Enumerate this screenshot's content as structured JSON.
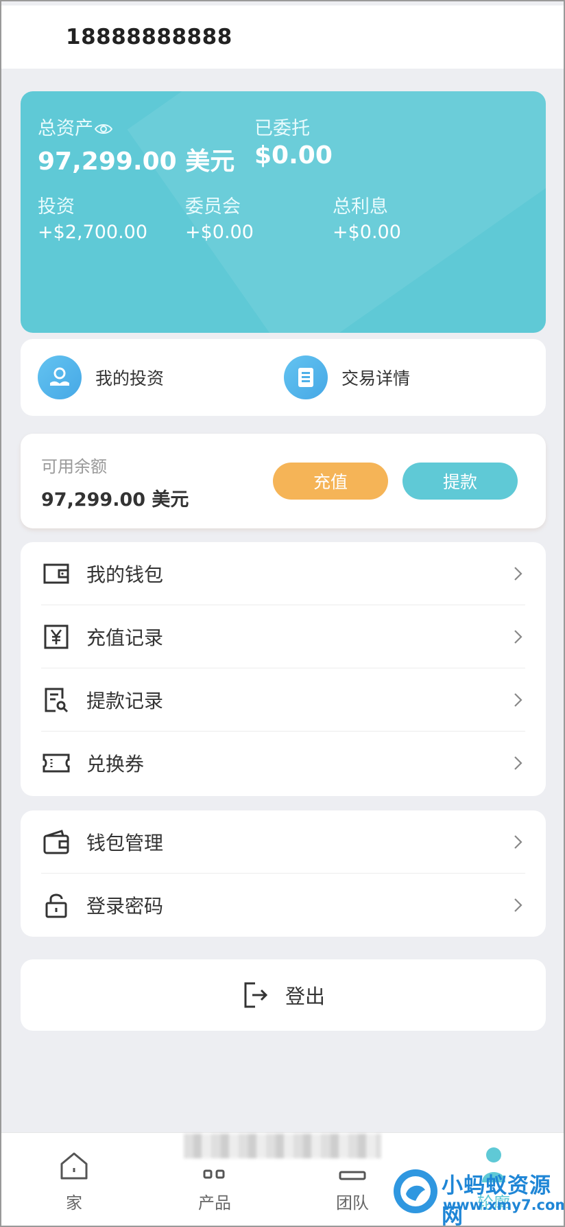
{
  "header": {
    "phone": "18888888888"
  },
  "assets": {
    "total_label": "总资产",
    "total_value": "97,299.00 美元",
    "entrusted_label": "已委托",
    "entrusted_value": "$0.00",
    "investment_label": "投资",
    "investment_value": "+$2,700.00",
    "commission_label": "委员会",
    "commission_value": "+$0.00",
    "interest_label": "总利息",
    "interest_value": "+$0.00"
  },
  "quick_links": [
    {
      "label": "我的投资",
      "icon": "hand-coin-icon"
    },
    {
      "label": "交易详情",
      "icon": "document-icon"
    }
  ],
  "balance": {
    "label": "可用余额",
    "value": "97,299.00 美元",
    "recharge_label": "充值",
    "withdraw_label": "提款"
  },
  "menu_primary": [
    {
      "label": "我的钱包",
      "icon": "wallet-icon"
    },
    {
      "label": "充值记录",
      "icon": "yen-box-icon"
    },
    {
      "label": "提款记录",
      "icon": "receipt-search-icon"
    },
    {
      "label": "兑换券",
      "icon": "ticket-icon"
    }
  ],
  "menu_secondary": [
    {
      "label": "钱包管理",
      "icon": "wallet-manage-icon"
    },
    {
      "label": "登录密码",
      "icon": "lock-icon"
    }
  ],
  "logout": {
    "label": "登出"
  },
  "nav": [
    {
      "label": "家",
      "icon": "home-icon"
    },
    {
      "label": "产品",
      "icon": "product-icon"
    },
    {
      "label": "团队",
      "icon": "team-icon"
    },
    {
      "label": "轮廓",
      "icon": "profile-icon"
    }
  ],
  "watermark": {
    "title": "小蚂蚁资源网",
    "url": "www.xmy7.com"
  },
  "colors": {
    "accent": "#5fc9d6",
    "orange": "#f5b457",
    "background": "#edeef2"
  }
}
